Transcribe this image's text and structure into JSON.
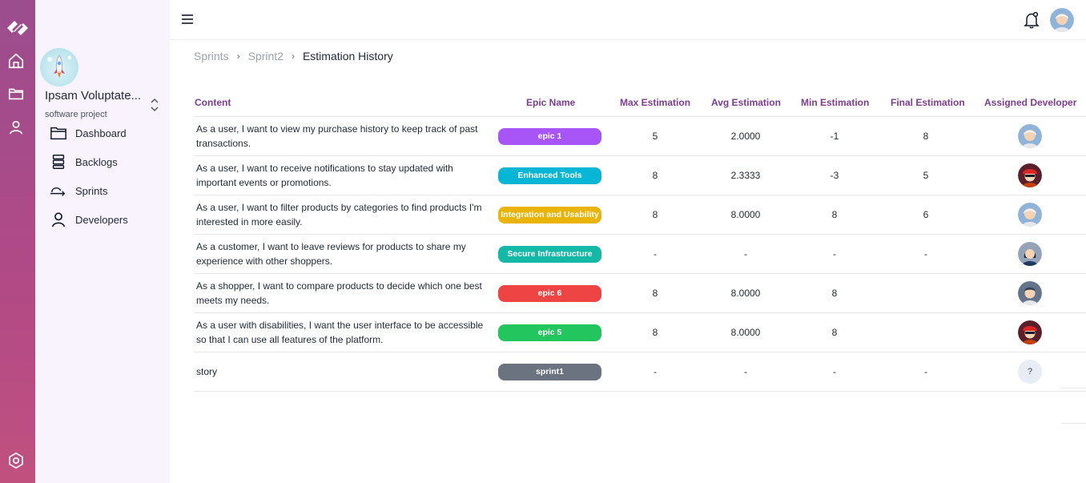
{
  "rail": {
    "logo": "app-logo",
    "icons": [
      "home-icon",
      "folder-icon",
      "user-icon",
      "settings-icon"
    ]
  },
  "project": {
    "name": "Ipsam Voluptate...",
    "type": "software project"
  },
  "nav": [
    {
      "label": "Dashboard",
      "icon": "folder-icon"
    },
    {
      "label": "Backlogs",
      "icon": "stack-icon"
    },
    {
      "label": "Sprints",
      "icon": "sprint-icon"
    },
    {
      "label": "Developers",
      "icon": "user-icon"
    }
  ],
  "breadcrumb": {
    "items": [
      "Sprints",
      "Sprint2"
    ],
    "current": "Estimation History"
  },
  "table": {
    "columns": [
      "Content",
      "Epic Name",
      "Max Estimation",
      "Avg Estimation",
      "Min Estimation",
      "Final Estimation",
      "Assigned Developer"
    ],
    "rows": [
      {
        "content": "As a user, I want to view my purchase history to keep track of past transactions.",
        "epic": "epic 1",
        "epic_color": "#a855f7",
        "max": "5",
        "avg": "2.0000",
        "min": "-1",
        "final": "8",
        "developer": "white-hair-avatar"
      },
      {
        "content": "As a user, I want to receive notifications to stay updated with important events or promotions.",
        "epic": "Enhanced Tools",
        "epic_color": "#06b6d4",
        "max": "8",
        "avg": "2.3333",
        "min": "-3",
        "final": "5",
        "developer": "red-hat-avatar"
      },
      {
        "content": "As a user, I want to filter products by categories to find products I'm interested in more easily.",
        "epic": "Integration and Usability",
        "epic_color": "#eab308",
        "max": "8",
        "avg": "8.0000",
        "min": "8",
        "final": "6",
        "developer": "white-hair-avatar"
      },
      {
        "content": "As a customer, I want to leave reviews for products to share my experience with other shoppers.",
        "epic": "Secure Infrastructure",
        "epic_color": "#14b8a6",
        "max": "-",
        "avg": "-",
        "min": "-",
        "final": "-",
        "developer": "dark-hair-avatar"
      },
      {
        "content": "As a shopper, I want to compare products to decide which one best meets my needs.",
        "epic": "epic 6",
        "epic_color": "#ef4444",
        "max": "8",
        "avg": "8.0000",
        "min": "8",
        "final": "",
        "developer": "gray-hair-avatar"
      },
      {
        "content": "As a user with disabilities, I want the user interface to be accessible so that I can use all features of the platform.",
        "epic": "epic 5",
        "epic_color": "#22c55e",
        "max": "8",
        "avg": "8.0000",
        "min": "8",
        "final": "",
        "developer": "red-hat-avatar"
      },
      {
        "content": "story",
        "epic": "sprint1",
        "epic_color": "#6b7280",
        "max": "-",
        "avg": "-",
        "min": "-",
        "final": "-",
        "developer": "?"
      }
    ]
  },
  "topbar": {
    "menu_icon": "hamburger-icon",
    "bell_icon": "bell-icon",
    "avatar": "white-hair-avatar"
  }
}
